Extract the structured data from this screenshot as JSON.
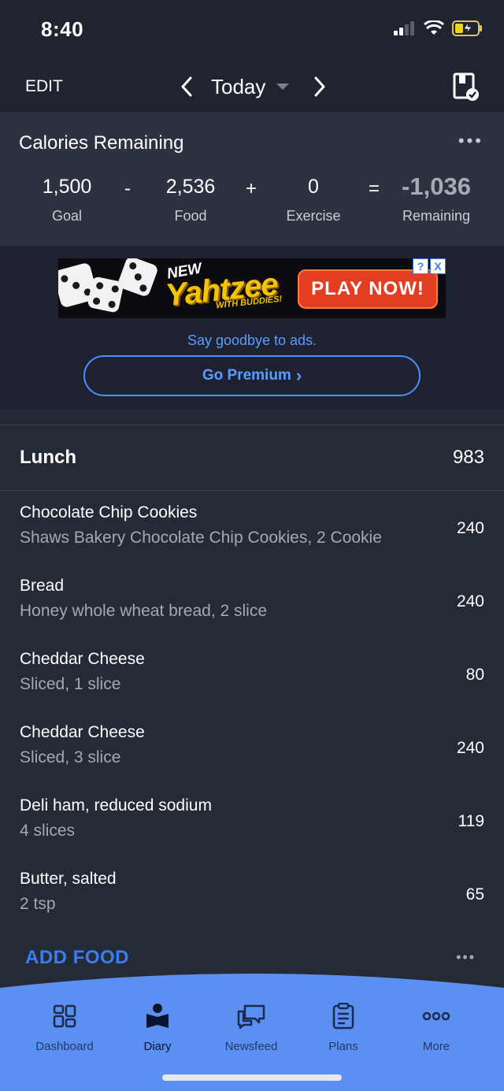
{
  "status_bar": {
    "time": "8:40"
  },
  "header": {
    "edit_label": "EDIT",
    "date_label": "Today"
  },
  "calories": {
    "title": "Calories Remaining",
    "goal": {
      "value": "1,500",
      "label": "Goal"
    },
    "minus": "-",
    "food": {
      "value": "2,536",
      "label": "Food"
    },
    "plus": "+",
    "exercise": {
      "value": "0",
      "label": "Exercise"
    },
    "equals": "=",
    "remaining": {
      "value": "-1,036",
      "label": "Remaining"
    }
  },
  "ad": {
    "new_text": "NEW",
    "logo_text": "Yahtzee",
    "buddies_text": "WITH BUDDIES!",
    "play_text": "PLAY NOW!",
    "info_symbol": "?",
    "close_symbol": "X",
    "goodbye_text": "Say goodbye to ads.",
    "premium_label": "Go Premium",
    "premium_chevron": "›"
  },
  "meal": {
    "name": "Lunch",
    "calories": "983",
    "items": [
      {
        "name": "Chocolate Chip Cookies",
        "desc": "Shaws Bakery Chocolate Chip Cookies, 2 Cookie",
        "cal": "240"
      },
      {
        "name": "Bread",
        "desc": "Honey whole wheat bread, 2 slice",
        "cal": "240"
      },
      {
        "name": "Cheddar Cheese",
        "desc": "Sliced, 1 slice",
        "cal": "80"
      },
      {
        "name": "Cheddar Cheese",
        "desc": "Sliced, 3 slice",
        "cal": "240"
      },
      {
        "name": "Deli ham, reduced sodium",
        "desc": "4 slices",
        "cal": "119"
      },
      {
        "name": "Butter, salted",
        "desc": "2 tsp",
        "cal": "65"
      }
    ],
    "add_food_label": "ADD FOOD"
  },
  "tabs": [
    {
      "label": "Dashboard",
      "icon": "dashboard-icon"
    },
    {
      "label": "Diary",
      "icon": "diary-icon",
      "active": true
    },
    {
      "label": "Newsfeed",
      "icon": "newsfeed-icon"
    },
    {
      "label": "Plans",
      "icon": "plans-icon"
    },
    {
      "label": "More",
      "icon": "more-icon"
    }
  ],
  "colors": {
    "background": "#252a37",
    "accent": "#3b7cf0",
    "tabbar": "#5b8ff2"
  }
}
